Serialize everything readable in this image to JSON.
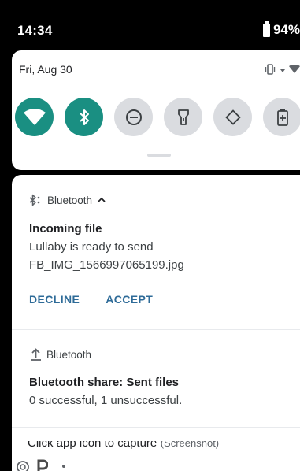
{
  "status_bar": {
    "time": "14:34",
    "battery": "94%"
  },
  "quick_settings": {
    "date": "Fri, Aug 30",
    "tiles": [
      {
        "icon": "wifi-icon",
        "state": "on"
      },
      {
        "icon": "bluetooth-icon",
        "state": "on"
      },
      {
        "icon": "do-not-disturb-icon",
        "state": "off"
      },
      {
        "icon": "flashlight-icon",
        "state": "off"
      },
      {
        "icon": "auto-rotate-icon",
        "state": "off"
      },
      {
        "icon": "battery-saver-icon",
        "state": "off"
      }
    ],
    "accent_color": "#1a8f82"
  },
  "notifications": [
    {
      "app": "Bluetooth",
      "title": "Incoming file",
      "line1": "Lullaby is ready to send",
      "line2": "FB_IMG_1566997065199.jpg",
      "actions": [
        "DECLINE",
        "ACCEPT"
      ]
    },
    {
      "app": "Bluetooth",
      "title": "Bluetooth share: Sent files",
      "line1": "0 successful, 1 unsuccessful."
    }
  ],
  "peek": {
    "text": "Click app icon to capture",
    "suffix": "(Screenshot)"
  }
}
